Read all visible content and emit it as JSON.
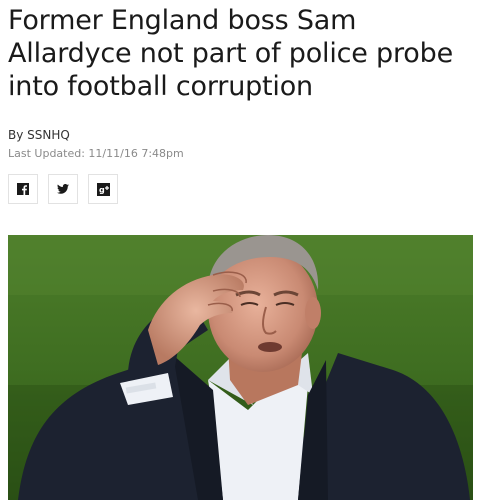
{
  "article": {
    "headline": "Former England boss Sam Allardyce not part of police probe into football corruption",
    "byline": "By SSNHQ",
    "last_updated": "Last Updated: 11/11/16 7:48pm"
  },
  "share": {
    "buttons": [
      {
        "icon": "facebook-icon"
      },
      {
        "icon": "twitter-icon"
      },
      {
        "icon": "google-plus-icon"
      }
    ]
  },
  "image": {
    "subject": "man-touching-forehead-photo"
  }
}
